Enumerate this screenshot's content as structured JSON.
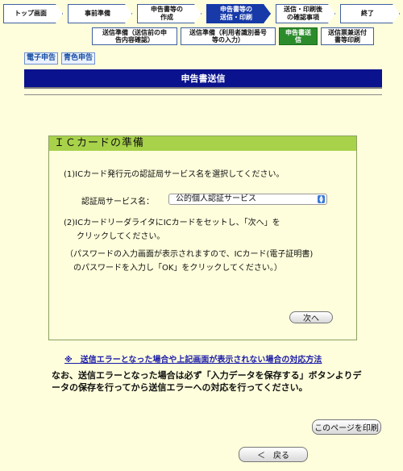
{
  "steps": [
    {
      "label": "トップ画面"
    },
    {
      "label": "事前準備"
    },
    {
      "label": "申告書等の\n作成"
    },
    {
      "label": "申告書等の\n送信・印刷"
    },
    {
      "label": "送信・印刷後\nの確認事項"
    },
    {
      "label": "終了"
    }
  ],
  "substeps": [
    {
      "label": "送信準備（送信前の申\n告内容確認）"
    },
    {
      "label": "送信準備（利用者識別番号\n等の入力）"
    },
    {
      "label": "申告書送\n信"
    },
    {
      "label": "送信票兼送付\n書等印刷"
    }
  ],
  "tags": [
    "電子申告",
    "青色申告"
  ],
  "banner": "申告書送信",
  "panel": {
    "title": "ＩＣカードの準備",
    "step1": "(1)ICカード発行元の認証局サービス名を選択してください。",
    "select_label": "認証局サービス名：",
    "select_value": "公的個人認証サービス",
    "step2_line1": "(2)ICカードリーダライタにICカードをセットし、「次へ」を",
    "step2_line2": "クリックしてください。",
    "note_line1": "（パスワードの入力画面が表示されますので、ICカード(電子証明書)",
    "note_line2": "のパスワードを入力し「OK」をクリックしてください。）",
    "next_button": "次へ"
  },
  "error_link": "※　送信エラーとなった場合や上記画面が表示されない場合の対応方法",
  "error_note": "なお、送信エラーとなった場合は必ず「入力データを保存する」ボタンよりデータの保存を行ってから送信エラーへの対応を行ってください。",
  "print_button": "このページを印刷",
  "back_button": "＜　戻る",
  "colors": {
    "background": "#fefedc",
    "banner": "#0a128e",
    "panel_header": "#a8d24a",
    "active_step": "#173aa8",
    "active_substep": "#2c8c2c"
  }
}
